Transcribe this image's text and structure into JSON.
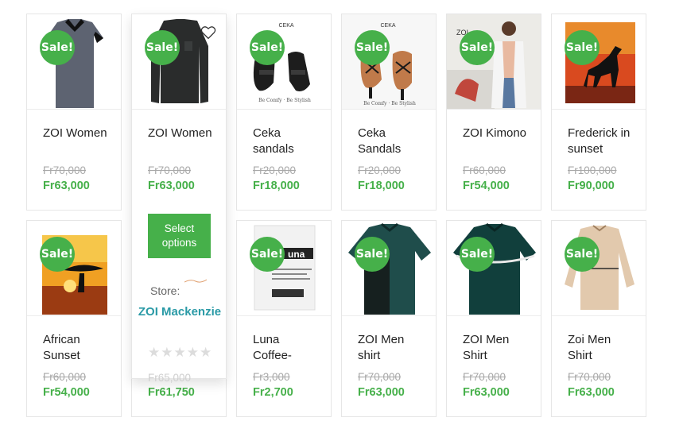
{
  "colors": {
    "accent_green": "#46b04a",
    "store_link": "#2a9aa6",
    "old_price": "#a8a8a8"
  },
  "sale_badge": "Sale!",
  "products": [
    {
      "name": "ZOI Women",
      "old_price": "Fr70,000",
      "price": "Fr63,000",
      "image": "grey-dress"
    },
    {
      "name": "ZOI Women",
      "old_price": "Fr70,000",
      "price": "Fr63,000",
      "image": "black-top"
    },
    {
      "name": "Ceka sandals",
      "old_price": "Fr20,000",
      "price": "Fr18,000",
      "image": "black-sandals"
    },
    {
      "name": "Ceka Sandals",
      "old_price": "Fr20,000",
      "price": "Fr18,000",
      "image": "tan-sandals"
    },
    {
      "name": "ZOI Kimono",
      "old_price": "Fr60,000",
      "price": "Fr54,000",
      "image": "white-kimono"
    },
    {
      "name": "Frederick in sunset",
      "old_price": "Fr100,000",
      "price": "Fr90,000",
      "image": "horse-painting"
    },
    {
      "name": "African Sunset",
      "old_price": "Fr60,000",
      "price": "Fr54,000",
      "image": "sunset-painting"
    },
    {
      "name": "",
      "old_price": "Fr65,000",
      "price": "Fr61,750",
      "image": ""
    },
    {
      "name": "Luna Coffee-",
      "old_price": "Fr3,000",
      "price": "Fr2,700",
      "image": "coffee-bag"
    },
    {
      "name": "ZOI Men shirt",
      "old_price": "Fr70,000",
      "price": "Fr63,000",
      "image": "green-shirt"
    },
    {
      "name": "ZOI Men Shirt",
      "old_price": "Fr70,000",
      "price": "Fr63,000",
      "image": "green-shirt-stripe"
    },
    {
      "name": "Zoi Men Shirt",
      "old_price": "Fr70,000",
      "price": "Fr63,000",
      "image": "beige-shirt"
    }
  ],
  "hover": {
    "select_label": "Select options",
    "store_label": "Store:",
    "store_name": "ZOI Mackenzie",
    "stars": "★★★★★",
    "faded_old_price": "Fr65,000"
  },
  "icons": {
    "wishlist": "heart-outline-icon"
  }
}
